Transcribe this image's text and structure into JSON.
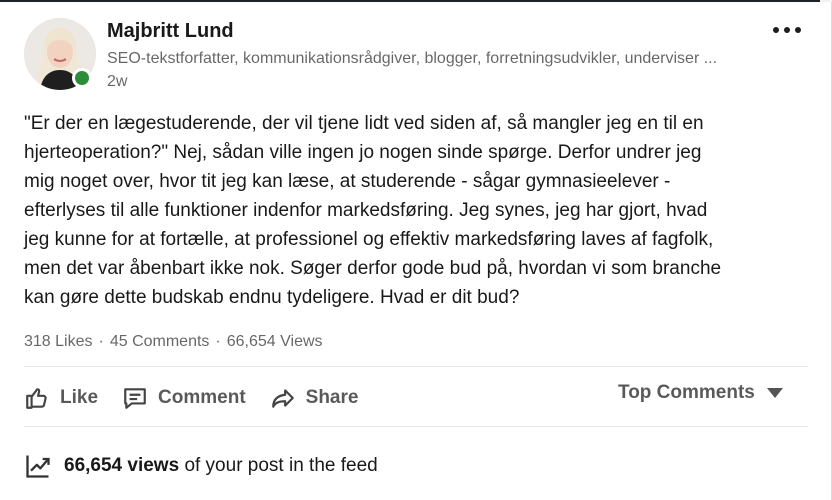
{
  "post": {
    "author": {
      "name": "Majbritt Lund",
      "headline": "SEO-tekstforfatter, kommunikationsrådgiver, blogger, forretningsudvikler, underviser ...",
      "time": "2w",
      "status": "online"
    },
    "body_lines": [
      "\"Er der en lægestuderende, der vil tjene lidt ved siden af, så mangler jeg en til en",
      "hjerteoperation?\" Nej, sådan ville ingen jo nogen sinde spørge. Derfor undrer jeg",
      "mig noget over, hvor tit jeg kan læse, at studerende - sågar gymnasieelever -",
      "efterlyses til alle funktioner indenfor markedsføring. Jeg synes, jeg har gjort, hvad",
      "jeg kunne for at fortælle, at professionel og effektiv markedsføring laves af fagfolk,",
      "men det var åbenbart ikke nok. Søger derfor gode bud på, hvordan vi som branche",
      "kan gøre dette budskab endnu tydeligere. Hvad er dit bud?"
    ],
    "social": {
      "likes": "318 Likes",
      "comments": "45 Comments",
      "views": "66,654 Views",
      "separator": "·"
    }
  },
  "actions": {
    "like": "Like",
    "comment": "Comment",
    "share": "Share",
    "sort": "Top Comments"
  },
  "analytics": {
    "views_bold": "66,654 views",
    "views_rest": "of your post in the feed"
  },
  "icons": {
    "like": "thumbs-up-icon",
    "comment": "comment-icon",
    "share": "share-arrow-icon",
    "sort": "caret-down-icon",
    "analytics": "trending-up-icon",
    "more": "more-options-icon"
  },
  "colors": {
    "presence": "#2e8b3a",
    "text_primary": "#1d1d1d",
    "text_secondary": "#666666"
  }
}
